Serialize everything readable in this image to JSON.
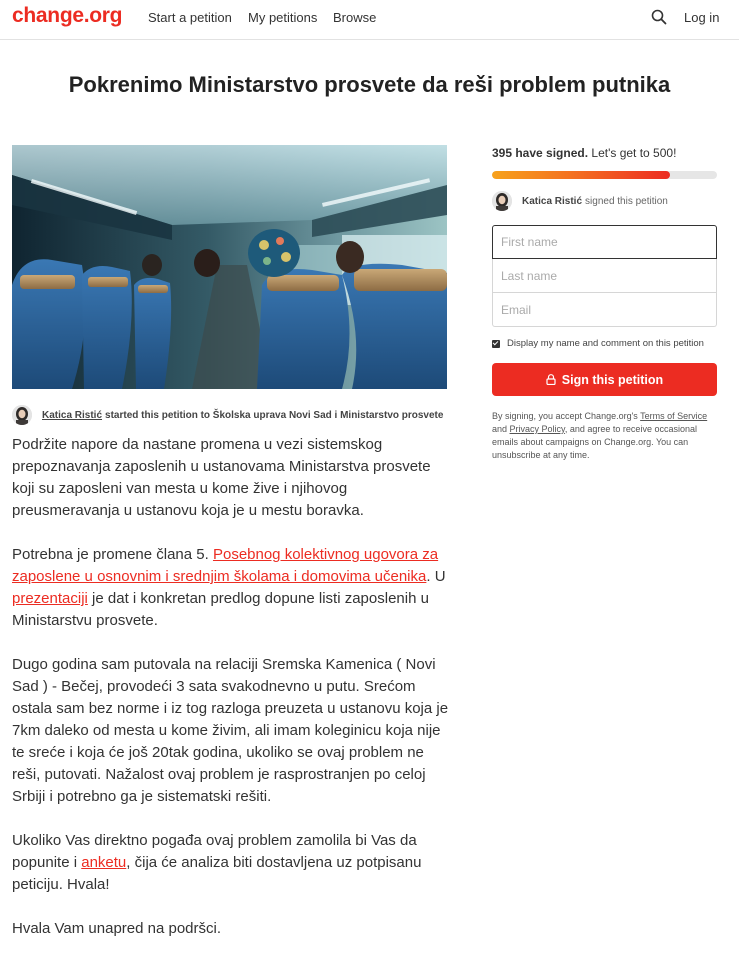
{
  "header": {
    "logo": "change.org",
    "nav": [
      "Start a petition",
      "My petitions",
      "Browse"
    ],
    "login": "Log in",
    "search_icon": "search-icon"
  },
  "petition": {
    "title": "Pokrenimo Ministarstvo prosvete da reši problem putnika",
    "starter_name": "Katica Ristić",
    "starter_rest": "started this petition to Školska uprava Novi Sad i Ministarstvo prosvete",
    "p1": "Podržite napore da nastane promena u vezi sistemskog prepoznavanja zaposlenih u ustanovama Ministarstva prosvete koji su zaposleni van mesta u kome žive i njihovog preusmeravanja u ustanovu koja je u mestu boravka.",
    "p2_before": "Potrebna je promene člana 5. ",
    "p2_link1": "Posebnog kolektivnog ugovora za zaposlene u osnovnim i srednjim školama i domovima učenika",
    "p2_mid": ". U ",
    "p2_link2": "prezentaciji",
    "p2_after": " je dat i konkretan predlog dopune listi zaposlenih u Ministarstvu prosvete.",
    "p3": "Dugo godina sam putovala na relaciji Sremska Kamenica ( Novi Sad ) - Bečej, provodeći 3 sata svakodnevno u putu. Srećom ostala sam bez norme i iz tog razloga preuzeta u ustanovu koja je 7km daleko od mesta u kome živim, ali imam koleginicu koja nije te sreće i koja će još 20tak godina, ukoliko se ovaj problem ne reši, putovati. Nažalost ovaj problem je rasprostranjen po celoj Srbiji i potrebno ga je sistematski rešiti.",
    "p4_before": "Ukoliko Vas direktno pogađa ovaj problem zamolila bi Vas da popunite i ",
    "p4_link": "anketu",
    "p4_after": ", čija će analiza biti dostavljena uz potpisanu peticiju. Hvala!",
    "p5": "Hvala Vam unapred na podršci."
  },
  "sidebar": {
    "signed_count": "395 have signed.",
    "goal_text": "Let's get to 500!",
    "progress_fraction": 0.79,
    "signer_name": "Katica Ristić",
    "signer_rest": "signed this petition",
    "first_name_placeholder": "First name",
    "last_name_placeholder": "Last name",
    "email_placeholder": "Email",
    "display_label": "Display my name and comment on this petition",
    "sign_button": "Sign this petition",
    "legal_1": "By signing, you accept Change.org's ",
    "terms": "Terms of Service",
    "legal_and": " and ",
    "privacy": "Privacy Policy",
    "legal_2": ", and agree to receive occasional emails about campaigns on Change.org. You can unsubscribe at any time."
  },
  "colors": {
    "brand": "#ec2c22",
    "progress_start": "#f7a21c"
  }
}
